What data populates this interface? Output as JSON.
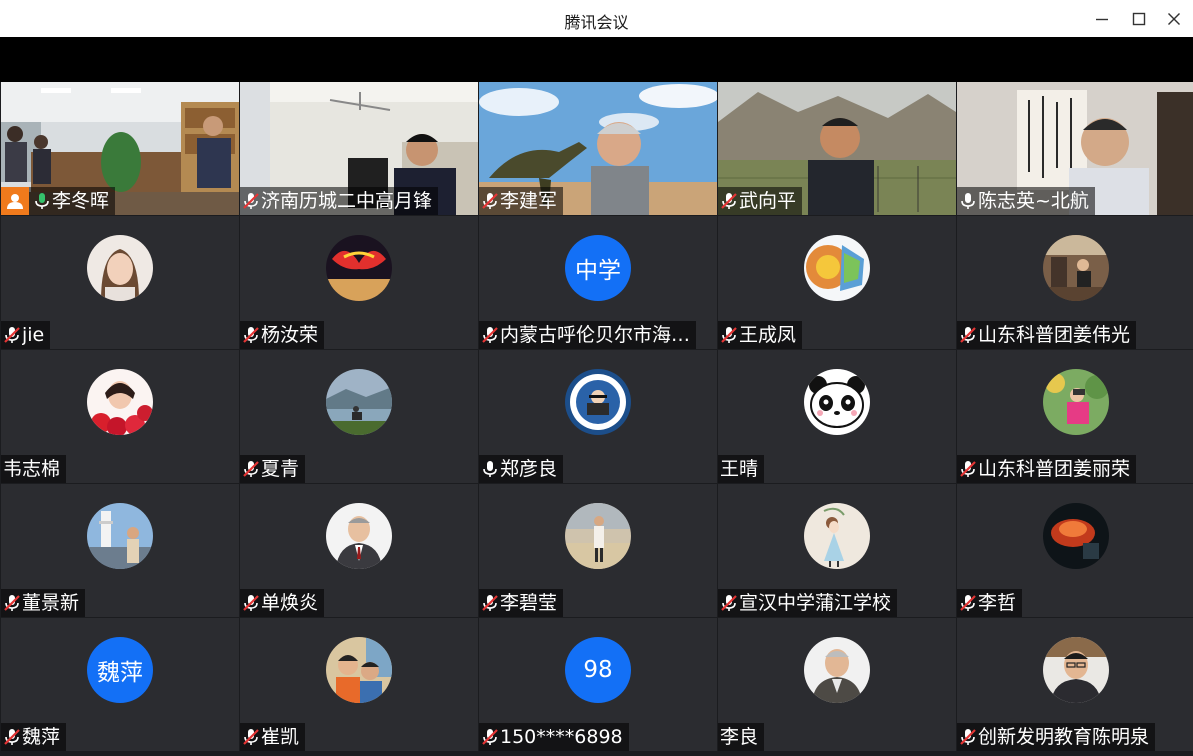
{
  "window": {
    "title": "腾讯会议"
  },
  "participants": [
    {
      "name": "李冬晖",
      "mic": "on-green",
      "host": true,
      "video": "office"
    },
    {
      "name": "济南历城二中高月锋",
      "mic": "muted",
      "video": "classroom"
    },
    {
      "name": "李建军",
      "mic": "muted",
      "video": "dinosaur"
    },
    {
      "name": "武向平",
      "mic": "muted",
      "video": "mountain"
    },
    {
      "name": "陈志英~北航",
      "mic": "on",
      "video": "calligraphy"
    },
    {
      "name": "jie",
      "mic": "muted",
      "avatar": "photo-woman"
    },
    {
      "name": "杨汝荣",
      "mic": "muted",
      "avatar": "photo-colorful"
    },
    {
      "name": "内蒙古呼伦贝尔市海…",
      "mic": "muted",
      "avatar_text": "中学"
    },
    {
      "name": "王成凤",
      "mic": "muted",
      "avatar": "photo-globe"
    },
    {
      "name": "山东科普团姜伟光",
      "mic": "muted",
      "avatar": "photo-room"
    },
    {
      "name": "韦志棉",
      "mic": "none",
      "avatar": "photo-flowers"
    },
    {
      "name": "夏青",
      "mic": "muted",
      "avatar": "photo-lake"
    },
    {
      "name": "郑彦良",
      "mic": "on",
      "avatar": "photo-badge"
    },
    {
      "name": "王晴",
      "mic": "none",
      "avatar": "photo-panda"
    },
    {
      "name": "山东科普团姜丽荣",
      "mic": "muted",
      "avatar": "photo-garden"
    },
    {
      "name": "董景新",
      "mic": "muted",
      "avatar": "photo-tower"
    },
    {
      "name": "单焕炎",
      "mic": "muted",
      "avatar": "photo-man-suit"
    },
    {
      "name": "李碧莹",
      "mic": "muted",
      "avatar": "photo-beach"
    },
    {
      "name": "宣汉中学蒲江学校",
      "mic": "muted",
      "avatar": "photo-girl-drawing"
    },
    {
      "name": "李哲",
      "mic": "muted",
      "avatar": "photo-red-light"
    },
    {
      "name": "魏萍",
      "mic": "muted",
      "avatar_text": "魏萍"
    },
    {
      "name": "崔凯",
      "mic": "muted",
      "avatar": "photo-kids"
    },
    {
      "name": "150****6898",
      "mic": "muted",
      "avatar_text": "98"
    },
    {
      "name": "李良",
      "mic": "none",
      "avatar": "photo-man-old"
    },
    {
      "name": "创新发明教育陈明泉",
      "mic": "muted",
      "avatar": "photo-man-glasses"
    }
  ],
  "colors": {
    "host_badge": "#f07a1c",
    "active_border": "#2fb36a",
    "text_avatar": "#1370f6",
    "tile": "#2b2c30"
  }
}
